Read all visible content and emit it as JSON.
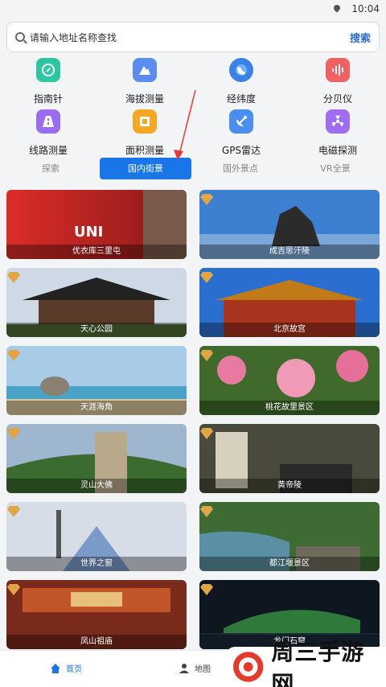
{
  "status_bar": {
    "time": "10:04",
    "icon": "location-pin-icon"
  },
  "search": {
    "placeholder": "请输入地址名称查找",
    "button": "搜索"
  },
  "tools": [
    {
      "label": "指南针",
      "icon": "compass-icon",
      "color": "#2ec5a1"
    },
    {
      "label": "海拔测量",
      "icon": "mountain-icon",
      "color": "#5b8cf0"
    },
    {
      "label": "经纬度",
      "icon": "globe-icon",
      "color": "#3b82e8"
    },
    {
      "label": "分贝仪",
      "icon": "soundwave-icon",
      "color": "#f06262"
    },
    {
      "label": "线路测量",
      "icon": "route-icon",
      "color": "#9a6cf0"
    },
    {
      "label": "面积测量",
      "icon": "area-icon",
      "color": "#f5a623"
    },
    {
      "label": "GPS雷达",
      "icon": "satellite-dish-icon",
      "color": "#4a8ef0"
    },
    {
      "label": "电磁探测",
      "icon": "radiation-icon",
      "color": "#a06cf0"
    }
  ],
  "tabs": [
    {
      "label": "探索",
      "active": false
    },
    {
      "label": "国内街景",
      "active": true
    },
    {
      "label": "国外景点",
      "active": false
    },
    {
      "label": "VR全景",
      "active": false
    }
  ],
  "cards": [
    {
      "title": "优衣库三里屯",
      "gem": false
    },
    {
      "title": "成吉思汗陵",
      "gem": true
    },
    {
      "title": "天心公园",
      "gem": true
    },
    {
      "title": "北京故宫",
      "gem": true
    },
    {
      "title": "天涯海角",
      "gem": true
    },
    {
      "title": "桃花故里景区",
      "gem": true
    },
    {
      "title": "灵山大佛",
      "gem": true
    },
    {
      "title": "黄帝陵",
      "gem": true
    },
    {
      "title": "世界之窗",
      "gem": true
    },
    {
      "title": "都江堰景区",
      "gem": true
    },
    {
      "title": "凤山祖庙",
      "gem": true
    },
    {
      "title": "龙门石窟",
      "gem": true
    }
  ],
  "bottom_nav": {
    "home": "首页",
    "map": "地图"
  },
  "watermark": {
    "text": "周三手游网"
  }
}
